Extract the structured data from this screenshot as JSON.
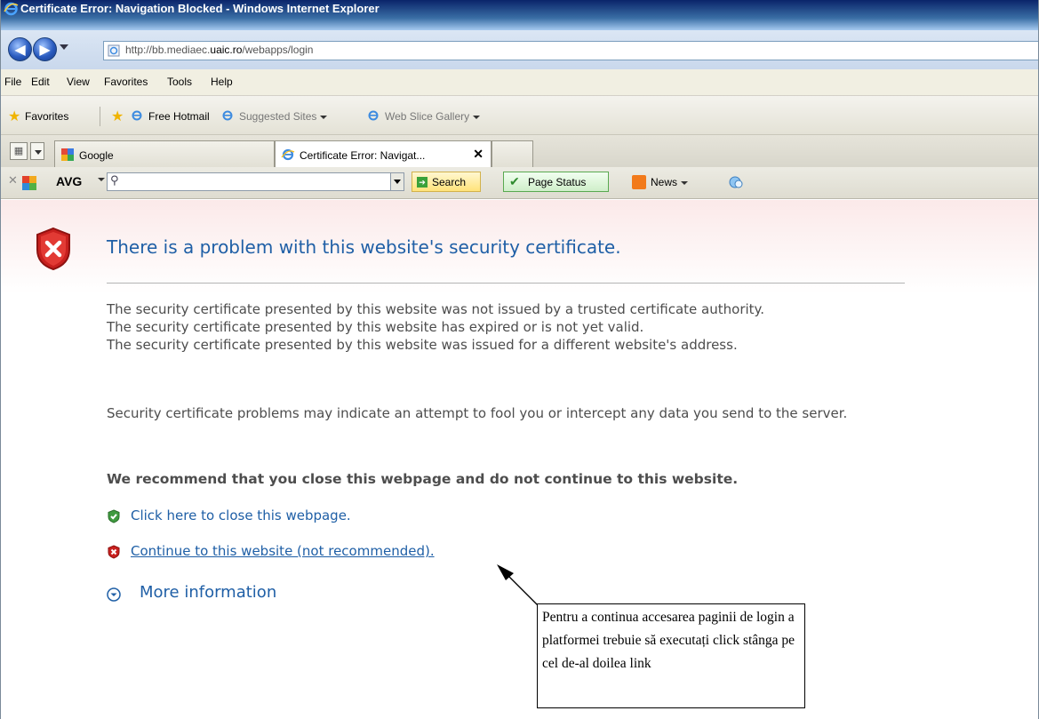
{
  "window": {
    "title": "Certificate Error: Navigation Blocked - Windows Internet Explorer"
  },
  "address": {
    "url_prefix": "http://bb.mediaec.",
    "url_domain": "uaic.ro",
    "url_suffix": "/webapps/login"
  },
  "menu": [
    "File",
    "Edit",
    "View",
    "Favorites",
    "Tools",
    "Help"
  ],
  "favorites_bar": {
    "favorites_label": "Favorites",
    "free_hotmail": "Free Hotmail",
    "suggested_sites": "Suggested Sites",
    "web_slice_gallery": "Web Slice Gallery"
  },
  "tabs": [
    {
      "label": "Google",
      "active": false
    },
    {
      "label": "Certificate Error: Navigat...",
      "active": true,
      "close": "✕"
    }
  ],
  "avg_toolbar": {
    "brand": "AVG",
    "search_button": "Search",
    "page_status_button": "Page Status",
    "news_label": "News"
  },
  "page": {
    "headline": "There is a problem with this website's security certificate.",
    "reason_lines": [
      "The security certificate presented by this website was not issued by a trusted certificate authority.",
      "The security certificate presented by this website has expired or is not yet valid.",
      "The security certificate presented by this website was issued for a different website's address."
    ],
    "warning": "Security certificate problems may indicate an attempt to fool you or intercept any data you send to the server.",
    "recommendation": "We recommend that you close this webpage and do not continue to this website.",
    "close_link": "Click here to close this webpage.",
    "continue_link": "Continue to this website (not recommended).",
    "more_info": "More information"
  },
  "annotation": {
    "text": "Pentru a continua accesarea paginii de login a platformei trebuie să executați click stânga pe cel de-al doilea link"
  },
  "colors": {
    "link_blue": "#1f5fa6",
    "body_gray": "#4d4d4d",
    "shield_red": "#c8201e",
    "shield_green": "#3f9a3f"
  }
}
